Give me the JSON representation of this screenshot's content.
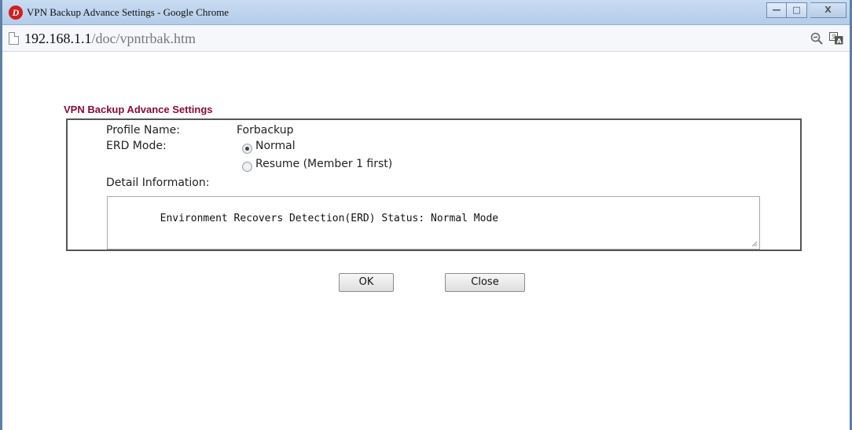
{
  "window": {
    "title": "VPN Backup Advance Settings - Google Chrome",
    "controls": {
      "minimize": "—",
      "maximize": "□",
      "close": "X"
    }
  },
  "address": {
    "host": "192.168.1.1",
    "path": "/doc/vpntrbak.htm"
  },
  "page": {
    "section_title": "VPN Backup Advance Settings",
    "profile_name_label": "Profile Name:",
    "profile_name_value": "Forbackup",
    "erd_mode_label": "ERD Mode:",
    "erd_options": [
      {
        "label": "Normal",
        "checked": true
      },
      {
        "label": "Resume (Member 1 first)",
        "checked": false
      }
    ],
    "detail_label": "Detail Information:",
    "detail_text": "Environment Recovers Detection(ERD) Status: Normal Mode",
    "ok_label": "OK",
    "close_label": "Close"
  },
  "colors": {
    "section_title": "#8b0a3a",
    "titlebar": "#c8dcf2"
  }
}
